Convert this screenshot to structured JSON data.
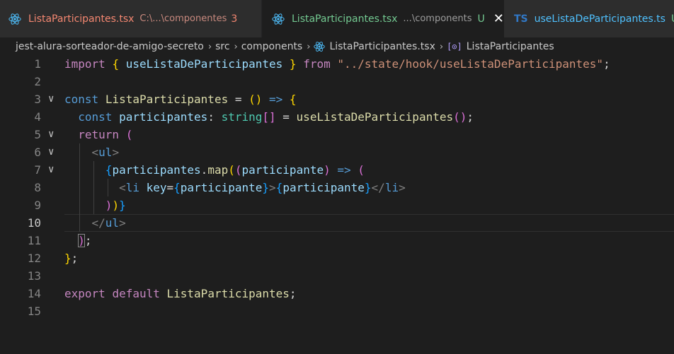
{
  "tabs": [
    {
      "icon": "react-icon",
      "name": "ListaParticipantes.tsx",
      "path": "C:\\...\\componentes",
      "badge": "3"
    },
    {
      "icon": "react-icon",
      "name": "ListaParticipantes.tsx",
      "path": "...\\components",
      "badge": "U",
      "close": "✕"
    },
    {
      "icon": "ts-icon",
      "icon_text": "TS",
      "name": "useListaDeParticipantes.ts",
      "badge": "U"
    }
  ],
  "breadcrumb": {
    "items": [
      "jest-alura-sorteador-de-amigo-secreto",
      "src",
      "components",
      "ListaParticipantes.tsx",
      "ListaParticipantes"
    ],
    "symbol_icon": "[⊙]",
    "separator": "›"
  },
  "editor": {
    "active_line": 10,
    "line_numbers": [
      "1",
      "2",
      "3",
      "4",
      "5",
      "6",
      "7",
      "8",
      "9",
      "10",
      "11",
      "12",
      "13",
      "14",
      "15"
    ],
    "fold_glyph": "∨",
    "tokens": {
      "import": "import",
      "hook": "useListaDeParticipantes",
      "from": "from",
      "path": "\"../state/hook/useListaDeParticipantes\"",
      "const": "const",
      "component": "ListaParticipantes",
      "participantes": "participantes",
      "string_type": "string",
      "return": "return",
      "ul": "ul",
      "map": "map",
      "participante": "participante",
      "li": "li",
      "key": "key",
      "export": "export",
      "default": "default"
    }
  },
  "colors": {
    "background": "#1e1e1e",
    "tab_inactive": "#2d2d2d",
    "error_red": "#f48771",
    "untracked_green": "#73c991",
    "react_blue": "#4fc1ff",
    "ts_blue": "#3178c6"
  }
}
